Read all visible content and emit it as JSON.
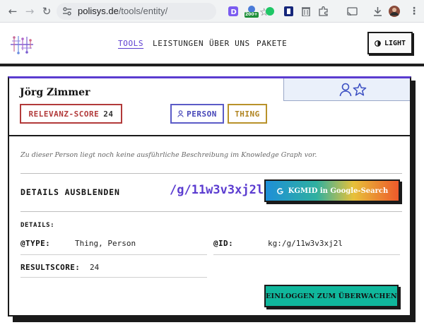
{
  "browser": {
    "url_domain": "polisys.de",
    "url_path": "/tools/entity/",
    "extensions": [
      "d-extension-icon",
      "counter-extension-icon",
      "green-dot-extension-icon",
      "shield-extension-icon",
      "trash-extension-icon",
      "puzzle-icon",
      "cast-icon",
      "download-icon",
      "profile-avatar"
    ],
    "counter_badge": "200+"
  },
  "header": {
    "nav": [
      {
        "label": "TOOLS",
        "active": true
      },
      {
        "label": "LEISTUNGEN",
        "active": false
      },
      {
        "label": "ÜBER UNS",
        "active": false
      },
      {
        "label": "PAKETE",
        "active": false
      }
    ],
    "theme_button": {
      "icon": "half-circle-icon",
      "label": "LIGHT"
    }
  },
  "entity": {
    "name": "Jörg Zimmer",
    "score_label": "RELEVANZ-SCORE",
    "score_value": "24",
    "types": [
      {
        "label": "PERSON",
        "icon": "person-icon",
        "color": "#4646b8"
      },
      {
        "label": "THING",
        "color": "#b08420"
      }
    ],
    "description": "Zu dieser Person liegt noch keine ausführliche Beschreibung im Knowledge Graph vor.",
    "details_toggle": "DETAILS AUSBLENDEN",
    "kgmid": "/g/11w3v3xj2l",
    "google_button": "KGMID in Google-Search",
    "details_heading": "DETAILS:",
    "fields": {
      "type_key": "@TYPE:",
      "type_value": "Thing, Person",
      "id_key": "@ID:",
      "id_value": "kg:/g/11w3v3xj2l",
      "resultscore_key": "RESULTSCORE:",
      "resultscore_value": "24"
    },
    "login_button": "EINLOGGEN ZUM ÜBERWACHEN"
  },
  "colors": {
    "accent": "#5b3cd0",
    "score": "#b23a3a",
    "person": "#5b5bc7",
    "thing": "#b8922a",
    "login": "#10b79c"
  }
}
